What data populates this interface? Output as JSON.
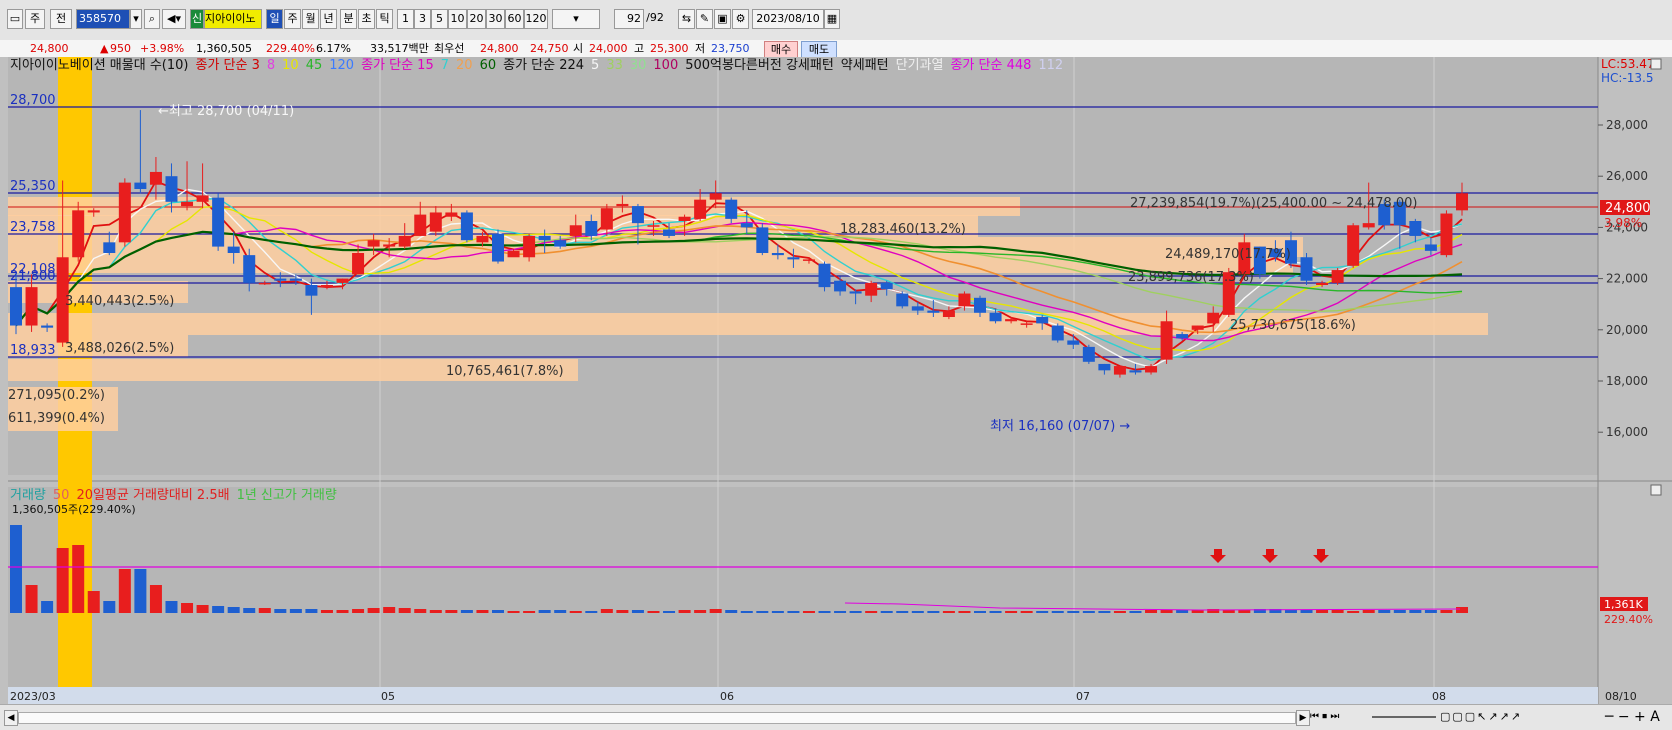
{
  "toolbar": {
    "period_select": "주",
    "field_select": "전",
    "code": "358570",
    "badge": "신",
    "stock_name": "지아이이노",
    "periods": [
      "일",
      "주",
      "월",
      "년"
    ],
    "minute_tick": [
      "분",
      "초",
      "틱"
    ],
    "intervals": [
      "1",
      "3",
      "5",
      "10",
      "20",
      "30",
      "60",
      "120"
    ],
    "count": "92",
    "count_total": "/92",
    "date": "2023/08/10"
  },
  "quote": {
    "price": "24,800",
    "change": "950",
    "change_pct": "+3.98%",
    "volume": "1,360,505",
    "volume_ratio": "229.40%",
    "turnover": "6.17%",
    "trade_amount": "33,517백만",
    "label_choi": "최우선",
    "ask": "24,800",
    "bid": "24,750",
    "open_label": "시",
    "open": "24,000",
    "high_label": "고",
    "high": "25,300",
    "low_label": "저",
    "low": "23,750",
    "buy_btn": "매수",
    "sell_btn": "매도"
  },
  "legend": [
    {
      "text": "지아이이노베이션 매물대 수(10)",
      "color": "#111111"
    },
    {
      "text": "종가 단순 3",
      "color": "#d00000"
    },
    {
      "text": "8",
      "color": "#e040e0"
    },
    {
      "text": "10",
      "color": "#e6e600"
    },
    {
      "text": "45",
      "color": "#29b629"
    },
    {
      "text": "120",
      "color": "#3b7bff"
    },
    {
      "text": "종가 단순 15",
      "color": "#e000c0"
    },
    {
      "text": "7",
      "color": "#30d0d0"
    },
    {
      "text": "20",
      "color": "#f0a050"
    },
    {
      "text": "60",
      "color": "#006000"
    },
    {
      "text": "종가 단순 224",
      "color": "#111111"
    },
    {
      "text": "5",
      "color": "#f7f7f7"
    },
    {
      "text": "33",
      "color": "#a0d060"
    },
    {
      "text": "30",
      "color": "#90e090"
    },
    {
      "text": "100",
      "color": "#b00060"
    },
    {
      "text": "500억봉다른버전 강세패턴",
      "color": "#111111"
    },
    {
      "text": "약세패턴",
      "color": "#111111"
    },
    {
      "text": "단기과열",
      "color": "#f0f0f0"
    },
    {
      "text": "종가 단순 448",
      "color": "#e000e0"
    },
    {
      "text": "112",
      "color": "#d0d0f0"
    }
  ],
  "right_info": {
    "lc": "LC:53.47",
    "hc": "HC:-13.5"
  },
  "price_axis": [
    "28,000",
    "26,000",
    "24,000",
    "22,000",
    "20,000",
    "18,000",
    "16,000"
  ],
  "price_tag": {
    "price": "24,800",
    "pct": "3.98%"
  },
  "hlines": [
    "28,700",
    "25,350",
    "23,758",
    "22,108",
    "21,800",
    "18,933"
  ],
  "max_label": "←최고 28,700 (04/11)",
  "min_label": "최저 16,160 (07/07) →",
  "volume_profile": [
    {
      "label": "27,239,854(19.7%)(25,400.00 ~ 24,478.00)"
    },
    {
      "label": "18,283,460(13.2%)"
    },
    {
      "label": "24,489,170(17.7%)"
    },
    {
      "label": "23,899,736(17.3%)"
    },
    {
      "label": "3,440,443(2.5%)"
    },
    {
      "label": "25,730,675(18.6%)"
    },
    {
      "label": "3,488,026(2.5%)"
    },
    {
      "label": "10,765,461(7.8%)"
    },
    {
      "label": "271,095(0.2%)"
    },
    {
      "label": "611,399(0.4%)"
    }
  ],
  "volume_legend": [
    {
      "text": "거래량",
      "color": "#20a0a0"
    },
    {
      "text": "50",
      "color": "#e06060"
    },
    {
      "text": "20일평균 거래량대비 2.5배",
      "color": "#e02020"
    },
    {
      "text": "1년 신고가 거래량",
      "color": "#40c040"
    }
  ],
  "volume_label": "1,360,505주(229.40%)",
  "volume_tag": {
    "value": "1,361K",
    "pct": "229.40%"
  },
  "x_labels": [
    "2023/03",
    "05",
    "06",
    "07",
    "08",
    "08/10"
  ],
  "colors": {
    "up": "#e81e1e",
    "down": "#1e5fd0",
    "highlight": "#ffc800",
    "profile": "#ffcfa0"
  }
}
